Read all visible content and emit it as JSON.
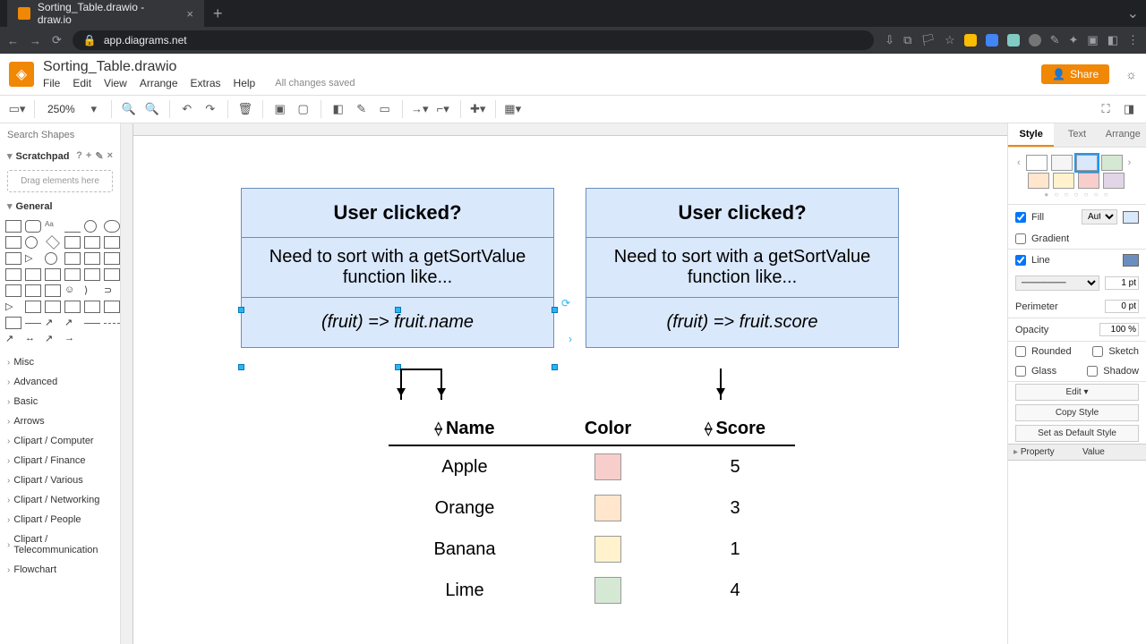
{
  "browser": {
    "tab_title": "Sorting_Table.drawio - draw.io",
    "url": "app.diagrams.net"
  },
  "header": {
    "doc_title": "Sorting_Table.drawio",
    "menus": [
      "File",
      "Edit",
      "View",
      "Arrange",
      "Extras",
      "Help"
    ],
    "save_status": "All changes saved",
    "share_label": "Share"
  },
  "toolbar": {
    "zoom": "250%"
  },
  "left": {
    "search_placeholder": "Search Shapes",
    "scratchpad_label": "Scratchpad",
    "scratchpad_drop": "Drag elements here",
    "general_label": "General",
    "categories": [
      "Misc",
      "Advanced",
      "Basic",
      "Arrows",
      "Clipart / Computer",
      "Clipart / Finance",
      "Clipart / Various",
      "Clipart / Networking",
      "Clipart / People",
      "Clipart / Telecommunication",
      "Flowchart"
    ]
  },
  "canvas": {
    "box_left": {
      "title": "User clicked?",
      "sub": "Need to sort with a getSortValue function like...",
      "code": "(fruit) => fruit.name"
    },
    "box_right": {
      "title": "User clicked?",
      "sub": "Need to sort with a getSortValue function like...",
      "code": "(fruit) => fruit.score"
    },
    "table": {
      "headers": [
        "Name",
        "Color",
        "Score"
      ],
      "rows": [
        {
          "name": "Apple",
          "color": "#f8cecc",
          "score": "5"
        },
        {
          "name": "Orange",
          "color": "#ffe6cc",
          "score": "3"
        },
        {
          "name": "Banana",
          "color": "#fff2cc",
          "score": "1"
        },
        {
          "name": "Lime",
          "color": "#d5e8d4",
          "score": "4"
        }
      ]
    }
  },
  "right": {
    "tabs": [
      "Style",
      "Text",
      "Arrange"
    ],
    "palette": [
      "#ffffff",
      "#f5f5f5",
      "#dae8fc",
      "#d5e8d4",
      "#ffe6cc",
      "#fff2cc",
      "#f8cecc",
      "#e1d5e7"
    ],
    "fill_label": "Fill",
    "fill_mode": "Auto",
    "gradient_label": "Gradient",
    "line_label": "Line",
    "line_width": "1 pt",
    "perimeter_label": "Perimeter",
    "perimeter_val": "0 pt",
    "opacity_label": "Opacity",
    "opacity_val": "100 %",
    "rounded_label": "Rounded",
    "sketch_label": "Sketch",
    "glass_label": "Glass",
    "shadow_label": "Shadow",
    "edit_label": "Edit",
    "copy_label": "Copy Style",
    "default_label": "Set as Default Style",
    "prop_header": "Property",
    "val_header": "Value"
  }
}
